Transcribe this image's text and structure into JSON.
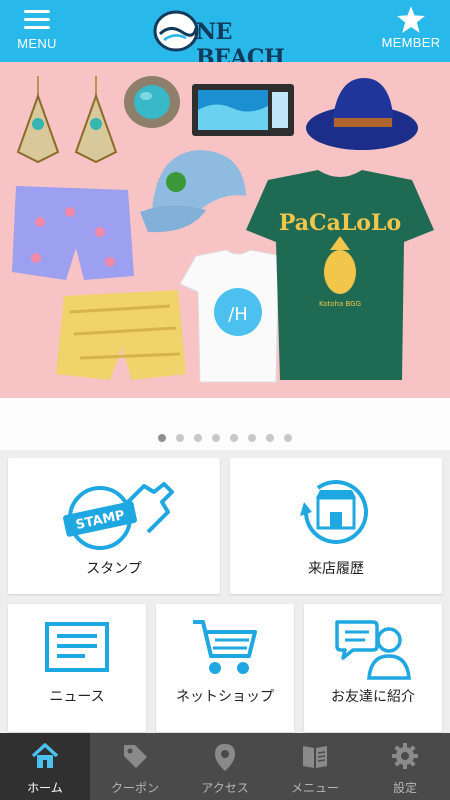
{
  "header": {
    "menu_label": "MENU",
    "member_label": "MEMBER",
    "logo_text": "NE BEACH",
    "bg_color": "#29b8ea"
  },
  "hero": {
    "bg_color": "#f7c3c5",
    "tshirt_print": "PaCaLoLo",
    "tshirt_sub": "Kotoha BGG",
    "white_tshirt_print": "/H"
  },
  "carousel": {
    "total": 8,
    "active": 0
  },
  "tiles": {
    "stamp": {
      "label": "スタンプ",
      "icon": "stamp-icon",
      "stamp_text": "STAMP"
    },
    "history": {
      "label": "来店履歴",
      "icon": "shop-history-icon"
    },
    "news": {
      "label": "ニュース",
      "icon": "news-icon"
    },
    "shop": {
      "label": "ネットショップ",
      "icon": "cart-icon"
    },
    "invite": {
      "label": "お友達に紹介",
      "icon": "friends-icon"
    }
  },
  "accent_color": "#1ea7e1",
  "tabs": [
    {
      "label": "ホーム",
      "icon": "home-icon",
      "active": true
    },
    {
      "label": "クーポン",
      "icon": "coupon-tag-icon",
      "active": false
    },
    {
      "label": "アクセス",
      "icon": "location-pin-icon",
      "active": false
    },
    {
      "label": "メニュー",
      "icon": "menu-book-icon",
      "active": false
    },
    {
      "label": "設定",
      "icon": "settings-gear-icon",
      "active": false
    }
  ]
}
